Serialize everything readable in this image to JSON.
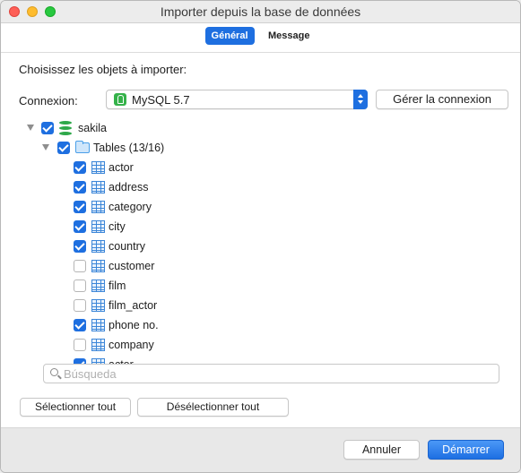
{
  "window": {
    "title": "Importer depuis la base de données"
  },
  "tabs": [
    {
      "label": "Général",
      "active": true
    },
    {
      "label": "Message",
      "active": false
    }
  ],
  "main": {
    "section_label": "Choisissez les objets à importer:",
    "connection_label": "Connexion:",
    "connection_value": "MySQL 5.7",
    "manage_button": "Gérer la connexion"
  },
  "tree": {
    "database": {
      "name": "sakila",
      "checked": true
    },
    "folder": {
      "label": "Tables (13/16)",
      "checked": true
    },
    "tables": [
      {
        "name": "actor",
        "checked": true
      },
      {
        "name": "address",
        "checked": true
      },
      {
        "name": "category",
        "checked": true
      },
      {
        "name": "city",
        "checked": true
      },
      {
        "name": "country",
        "checked": true
      },
      {
        "name": "customer",
        "checked": false
      },
      {
        "name": "film",
        "checked": false
      },
      {
        "name": "film_actor",
        "checked": false
      },
      {
        "name": "phone no.",
        "checked": true
      },
      {
        "name": "company",
        "checked": false
      },
      {
        "name": "actor",
        "checked": true
      }
    ]
  },
  "search": {
    "placeholder": "Búsqueda"
  },
  "selection_buttons": {
    "select_all": "Sélectionner tout",
    "deselect_all": "Désélectionner tout"
  },
  "footer": {
    "cancel": "Annuler",
    "start": "Démarrer"
  },
  "colors": {
    "accent": "#1e6fe0",
    "db_icon": "#2ea84a",
    "folder_icon": "#4a9fe8"
  }
}
